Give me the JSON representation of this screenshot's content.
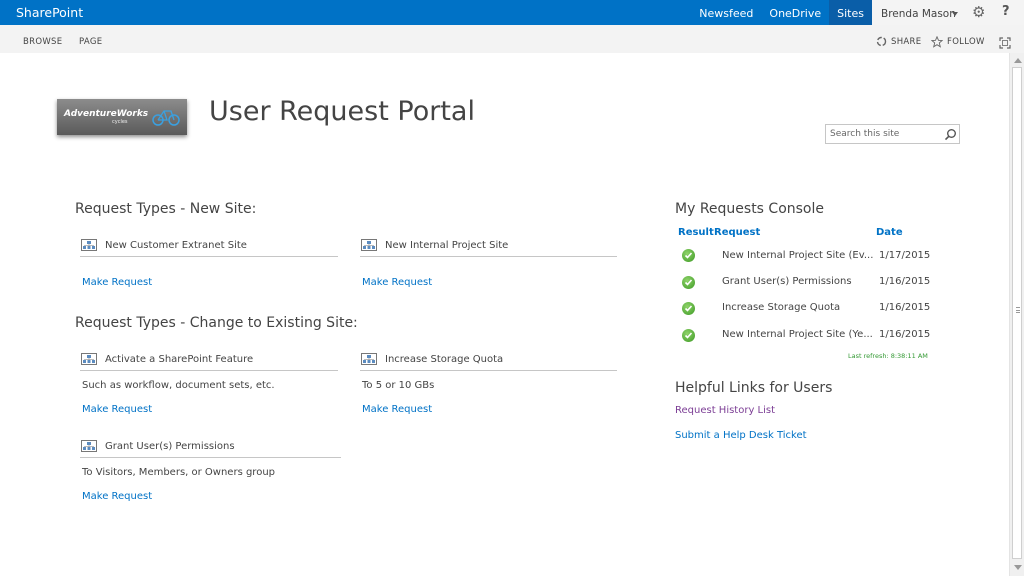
{
  "suitebar": {
    "brand": "SharePoint",
    "links": [
      "Newsfeed",
      "OneDrive",
      "Sites"
    ],
    "user": "Brenda Mason",
    "help": "?"
  },
  "ribbon": {
    "tabs": [
      "BROWSE",
      "PAGE"
    ],
    "share": "SHARE",
    "follow": "FOLLOW"
  },
  "logo": {
    "text": "AdventureWorks",
    "sub": "cycles"
  },
  "site_title": "User Request Portal",
  "search": {
    "placeholder": "Search this site"
  },
  "new_site": {
    "heading": "Request Types - New Site:",
    "items": [
      {
        "label": "New Customer Extranet Site",
        "action": "Make Request"
      },
      {
        "label": "New Internal Project Site",
        "action": "Make Request"
      }
    ]
  },
  "change_site": {
    "heading": "Request Types - Change to Existing Site:",
    "items": [
      {
        "label": "Activate a SharePoint Feature",
        "desc": "Such as workflow, document sets, etc.",
        "action": "Make Request"
      },
      {
        "label": "Increase Storage Quota",
        "desc": "To 5 or 10 GBs",
        "action": "Make Request"
      },
      {
        "label": "Grant User(s) Permissions",
        "desc": "To Visitors, Members, or Owners group",
        "action": "Make Request"
      }
    ]
  },
  "console": {
    "heading": "My Requests Console",
    "columns": [
      "Result",
      "Request",
      "Date"
    ],
    "rows": [
      {
        "request": "New Internal Project Site (Ev...",
        "date": "1/17/2015"
      },
      {
        "request": "Grant User(s) Permissions",
        "date": "1/16/2015"
      },
      {
        "request": "Increase Storage Quota",
        "date": "1/16/2015"
      },
      {
        "request": "New Internal Project Site (Ye...",
        "date": "1/16/2015"
      }
    ],
    "last_refresh": "Last refresh: 8:38:11 AM"
  },
  "helpful": {
    "heading": "Helpful Links for Users",
    "links": [
      "Request History List",
      "Submit a Help Desk Ticket"
    ]
  },
  "colors": {
    "suitebar": "#0072c6",
    "link": "#0072c6",
    "visited": "#7c3e95",
    "success": "#3d9a25"
  }
}
